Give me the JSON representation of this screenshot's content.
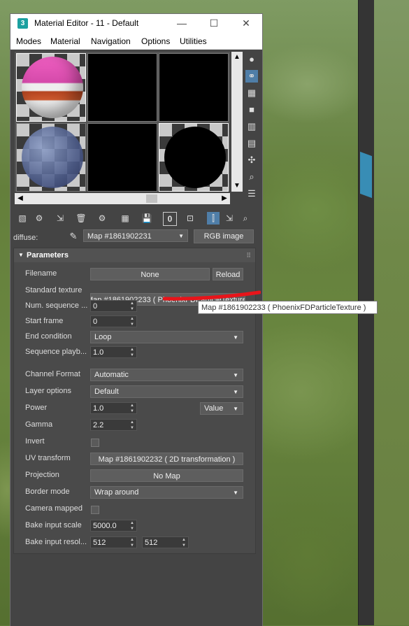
{
  "window": {
    "title": "Material Editor - 11 - Default",
    "app_icon": "3",
    "minimize": "—",
    "maximize": "☐",
    "close": "✕"
  },
  "menu": [
    "Modes",
    "Material",
    "Navigation",
    "Options",
    "Utilities"
  ],
  "navigation": {
    "map_name": "Map #1861902231",
    "map_type": "RGB image",
    "slot_label": "diffuse:"
  },
  "parameters": {
    "header": "Parameters",
    "filename_label": "Filename",
    "filename_value": "None",
    "reload_label": "Reload",
    "standard_texture_label": "Standard texture",
    "standard_texture_value": "Map #1861902233  ( PhoenixFDParticleTexture )",
    "num_sequence_label": "Num. sequence ...",
    "num_sequence_value": "0",
    "start_frame_label": "Start frame",
    "start_frame_value": "0",
    "end_condition_label": "End condition",
    "end_condition_value": "Loop",
    "sequence_playback_label": "Sequence playb...",
    "sequence_playback_value": "1.0",
    "channel_format_label": "Channel Format",
    "channel_format_value": "Automatic",
    "layer_options_label": "Layer options",
    "layer_options_value": "Default",
    "power_label": "Power",
    "power_value": "1.0",
    "power_mode_value": "Value",
    "gamma_label": "Gamma",
    "gamma_value": "2.2",
    "invert_label": "Invert",
    "uv_transform_label": "UV transform",
    "uv_transform_value": "Map #1861902232  ( 2D transformation )",
    "projection_label": "Projection",
    "projection_value": "No Map",
    "border_mode_label": "Border mode",
    "border_mode_value": "Wrap around",
    "camera_mapped_label": "Camera mapped",
    "bake_input_scale_label": "Bake input scale",
    "bake_input_scale_value": "5000.0",
    "bake_input_resolution_label": "Bake input resol...",
    "bake_input_resolution_x": "512",
    "bake_input_resolution_y": "512"
  },
  "tooltip": {
    "text": "Map #1861902233  ( PhoenixFDParticleTexture )"
  },
  "icons": {
    "arrow_down": "▼",
    "spin": "▲▼",
    "caret": "▼",
    "grip": "⠿",
    "scroll_up": "▲",
    "scroll_down": "▼",
    "scroll_left": "◀",
    "scroll_right": "▶",
    "eyedropper": "✎",
    "side_tools": [
      "●",
      "⚭",
      "▦",
      "■",
      "▥",
      "▤",
      "✣",
      "⌕",
      "☰"
    ],
    "bottom_tools": [
      "▧",
      "⚙",
      "⇲",
      "🗑",
      "⚙",
      "▦",
      "💾",
      "0",
      "⊡",
      "⫿",
      "⇲",
      "⌕"
    ]
  },
  "colors": {
    "highlight": "#4f7ea8",
    "annotation": "#e8141a"
  }
}
